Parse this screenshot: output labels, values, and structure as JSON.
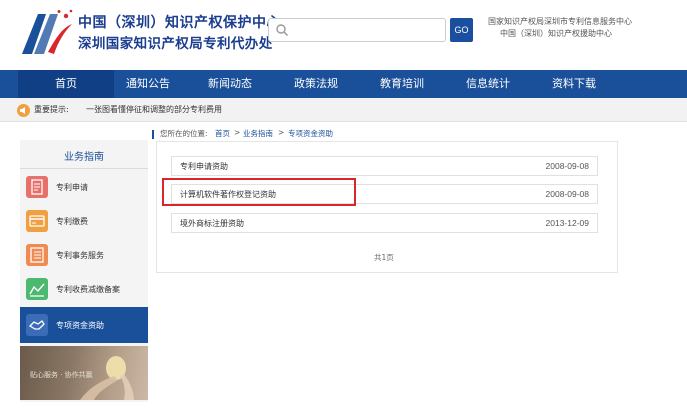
{
  "header": {
    "title_line1": "中国（深圳）知识产权保护中心",
    "title_line2": "深圳国家知识产权局专利代办处",
    "search_placeholder": "",
    "search_button": "GO",
    "right_line1": "国家知识产权局深圳市专利信息服务中心",
    "right_line2": "中国（深圳）知识产权援助中心",
    "brand_color": "#1a4f99"
  },
  "nav": {
    "items": [
      "首页",
      "通知公告",
      "新闻动态",
      "政策法规",
      "教育培训",
      "信息统计",
      "资料下载"
    ],
    "active_index": 0
  },
  "notice": {
    "icon": "speaker-icon",
    "label": "重要提示:",
    "text": "一张图看懂停征和调整的部分专利费用"
  },
  "breadcrumb": {
    "prefix": "您所在的位置:",
    "items": [
      "首页",
      "业务指南",
      "专项资金资助"
    ],
    "separator": ">"
  },
  "sidebar": {
    "title": "业务指南",
    "items": [
      {
        "label": "专利申请",
        "icon": "document-icon",
        "color": "#e8706a"
      },
      {
        "label": "专利缴费",
        "icon": "card-icon",
        "color": "#f0a040"
      },
      {
        "label": "专利事务服务",
        "icon": "list-icon",
        "color": "#f08a50"
      },
      {
        "label": "专利收费减缴备案",
        "icon": "chart-icon",
        "color": "#4cb870"
      },
      {
        "label": "专项资金资助",
        "icon": "handshake-icon",
        "color": "#1a4f99"
      }
    ],
    "active_index": 4,
    "banner_text": "贴心服务 · 协作共赢"
  },
  "content": {
    "rows": [
      {
        "title": "专利申请资助",
        "date": "2008-09-08"
      },
      {
        "title": "计算机软件著作权登记资助",
        "date": "2008-09-08"
      },
      {
        "title": "境外商标注册资助",
        "date": "2013-12-09"
      }
    ],
    "highlighted_index": 1,
    "highlight_color": "#d9262c",
    "pager": "共1页"
  }
}
